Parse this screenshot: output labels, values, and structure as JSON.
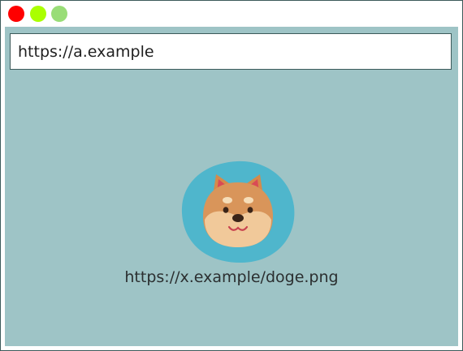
{
  "window": {
    "controls": [
      {
        "name": "close",
        "color": "#ff0000"
      },
      {
        "name": "minimize",
        "color": "#aaff00"
      },
      {
        "name": "maximize",
        "color": "#99dd77"
      }
    ]
  },
  "address_bar": {
    "value": "https://a.example"
  },
  "page": {
    "background": "#9ec4c6",
    "image": {
      "icon": "shiba-dog-face-icon",
      "caption": "https://x.example/doge.png"
    }
  }
}
